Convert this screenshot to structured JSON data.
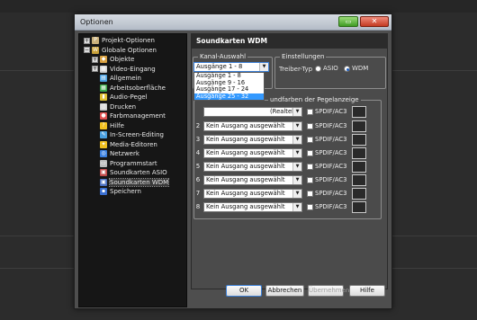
{
  "window": {
    "title": "Optionen",
    "min_glyph": "▭",
    "close_glyph": "✕"
  },
  "tree": {
    "items": [
      {
        "label": "Projekt-Optionen",
        "icon": "project-icon",
        "color": "#c9b07a",
        "glyph": "P",
        "expander": "+"
      },
      {
        "label": "Globale Optionen",
        "icon": "global-icon",
        "color": "#c9a23a",
        "glyph": "W",
        "expander": "−"
      },
      {
        "label": "Objekte",
        "icon": "objects-icon",
        "color": "#d8a040",
        "glyph": "◆",
        "expander": "+"
      },
      {
        "label": "Video-Eingang",
        "icon": "video-input-icon",
        "color": "#cfcfcf",
        "glyph": "▦",
        "expander": "+"
      },
      {
        "label": "Allgemein",
        "icon": "general-icon",
        "color": "#4aa0e0",
        "glyph": "▤",
        "expander": ""
      },
      {
        "label": "Arbeitsoberfläche",
        "icon": "workspace-icon",
        "color": "#3aa64a",
        "glyph": "▦",
        "expander": ""
      },
      {
        "label": "Audio-Pegel",
        "icon": "audio-level-icon",
        "color": "#e0c030",
        "glyph": "▮",
        "expander": ""
      },
      {
        "label": "Drucken",
        "icon": "print-icon",
        "color": "#cfcfcf",
        "glyph": "▥",
        "expander": ""
      },
      {
        "label": "Farbmanagement",
        "icon": "color-management-icon",
        "color": "#e05050",
        "glyph": "●",
        "expander": ""
      },
      {
        "label": "Hilfe",
        "icon": "help-icon",
        "color": "#f0c020",
        "glyph": "?",
        "expander": ""
      },
      {
        "label": "In-Screen-Editing",
        "icon": "in-screen-editing-icon",
        "color": "#4aa0e0",
        "glyph": "✎",
        "expander": ""
      },
      {
        "label": "Media-Editoren",
        "icon": "media-editors-icon",
        "color": "#f0c020",
        "glyph": "✦",
        "expander": ""
      },
      {
        "label": "Netzwerk",
        "icon": "network-icon",
        "color": "#3a80e0",
        "glyph": "◎",
        "expander": ""
      },
      {
        "label": "Programmstart",
        "icon": "program-start-icon",
        "color": "#bfbfbf",
        "glyph": "▭",
        "expander": ""
      },
      {
        "label": "Soundkarten ASIO",
        "icon": "soundcard-asio-icon",
        "color": "#c04a4a",
        "glyph": "▣",
        "expander": ""
      },
      {
        "label": "Soundkarten WDM",
        "icon": "soundcard-wdm-icon",
        "color": "#4a6fc0",
        "glyph": "▣",
        "expander": ""
      },
      {
        "label": "Speichern",
        "icon": "save-icon",
        "color": "#3a6fd0",
        "glyph": "▪",
        "expander": ""
      }
    ],
    "selected_index": 15
  },
  "panel": {
    "header": "Soundkarten WDM",
    "kanal": {
      "title": "Kanal-Auswahl",
      "selected": "Ausgänge  1 - 8",
      "options": [
        "Ausgänge  1 - 8",
        "Ausgänge  9 - 16",
        "Ausgänge 17 - 24",
        "Ausgänge 25 - 32"
      ],
      "highlighted_index": 3
    },
    "einstellungen": {
      "title": "Einstellungen",
      "treiber_label": "Treiber-Typ",
      "radio_asio": "ASIO",
      "radio_wdm": "WDM",
      "selected": "WDM"
    },
    "outputs": {
      "title_fragment": "undfarben der Pegelanzeige",
      "first_value_fragment": "(Realtek",
      "rows": [
        {
          "num": "2",
          "value": "Kein Ausgang ausgewählt",
          "spdif": "SPDIF/AC3"
        },
        {
          "num": "3",
          "value": "Kein Ausgang ausgewählt",
          "spdif": "SPDIF/AC3"
        },
        {
          "num": "4",
          "value": "Kein Ausgang ausgewählt",
          "spdif": "SPDIF/AC3"
        },
        {
          "num": "5",
          "value": "Kein Ausgang ausgewählt",
          "spdif": "SPDIF/AC3"
        },
        {
          "num": "6",
          "value": "Kein Ausgang ausgewählt",
          "spdif": "SPDIF/AC3"
        },
        {
          "num": "7",
          "value": "Kein Ausgang ausgewählt",
          "spdif": "SPDIF/AC3"
        },
        {
          "num": "8",
          "value": "Kein Ausgang ausgewählt",
          "spdif": "SPDIF/AC3"
        }
      ],
      "first_spdif": "SPDIF/AC3"
    }
  },
  "buttons": {
    "ok": "OK",
    "cancel": "Abbrechen",
    "apply": "Übernehmen",
    "help": "Hilfe"
  }
}
